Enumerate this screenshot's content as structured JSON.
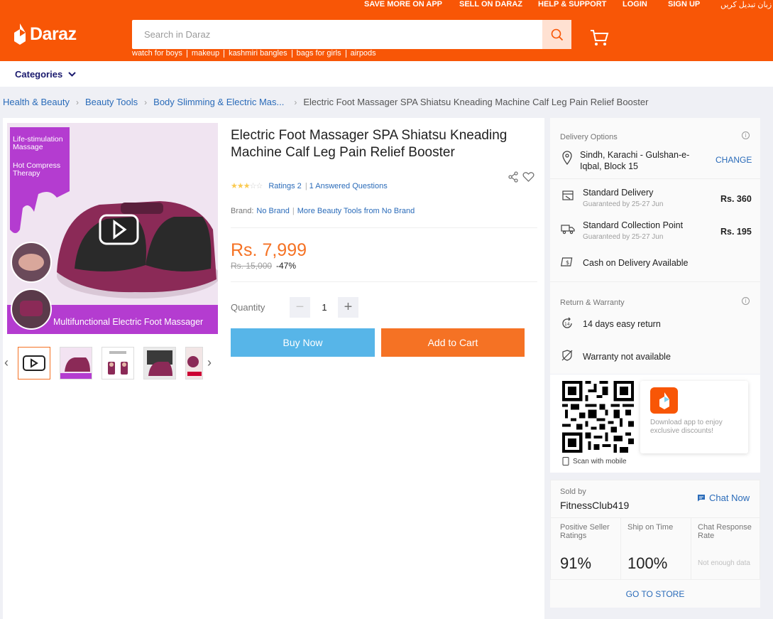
{
  "header": {
    "top_links": [
      "SAVE MORE ON APP",
      "SELL ON DARAZ",
      "HELP & SUPPORT",
      "LOGIN",
      "SIGN UP",
      "زبان تبدیل کریں"
    ],
    "logo_text": "Daraz",
    "search_placeholder": "Search in Daraz",
    "suggestions": [
      "watch for boys",
      "makeup",
      "kashmiri bangles",
      "bags for girls",
      "airpods"
    ],
    "brand_color": "#f85606"
  },
  "nav": {
    "categories_label": "Categories"
  },
  "breadcrumb": [
    "Health & Beauty",
    "Beauty Tools",
    "Body Slimming & Electric Mas...",
    "Electric Foot Massager SPA Shiatsu Kneading Machine Calf Leg Pain Relief Booster"
  ],
  "gallery": {
    "overlay_top_lines": [
      "Life-stimulation",
      "Massage",
      "Hot Compress",
      "Therapy"
    ],
    "overlay_bottom": "Multifunctional Electric Foot Massager"
  },
  "product": {
    "title": "Electric Foot Massager SPA Shiatsu Kneading Machine Calf Leg Pain Relief Booster",
    "rating_stars": 3,
    "ratings_label": "Ratings 2",
    "answered_label": "1 Answered Questions",
    "brand_label": "Brand:",
    "brand_value": "No Brand",
    "more_from": "More Beauty Tools from No Brand",
    "price": "Rs. 7,999",
    "old_price": "Rs. 15,000",
    "discount": "-47%",
    "quantity_label": "Quantity",
    "quantity": "1",
    "buy_now": "Buy Now",
    "add_to_cart": "Add to Cart"
  },
  "delivery": {
    "title": "Delivery Options",
    "location": "Sindh, Karachi - Gulshan-e-Iqbal, Block 15",
    "change": "CHANGE",
    "standard": {
      "label": "Standard Delivery",
      "sub": "Guaranteed by 25-27 Jun",
      "price": "Rs. 360"
    },
    "collection": {
      "label": "Standard Collection Point",
      "sub": "Guaranteed by 25-27 Jun",
      "price": "Rs. 195"
    },
    "cod": "Cash on Delivery Available"
  },
  "warranty": {
    "title": "Return & Warranty",
    "return": "14 days easy return",
    "warranty": "Warranty not available"
  },
  "app": {
    "promo": "Download app to enjoy exclusive discounts!",
    "scan": "Scan with mobile"
  },
  "seller": {
    "sold_by_label": "Sold by",
    "name": "FitnessClub419",
    "chat": "Chat Now",
    "metrics": [
      {
        "label": "Positive Seller Ratings",
        "value": "91%"
      },
      {
        "label": "Ship on Time",
        "value": "100%"
      },
      {
        "label": "Chat Response Rate",
        "value": "Not enough data"
      }
    ],
    "go_store": "GO TO STORE"
  }
}
